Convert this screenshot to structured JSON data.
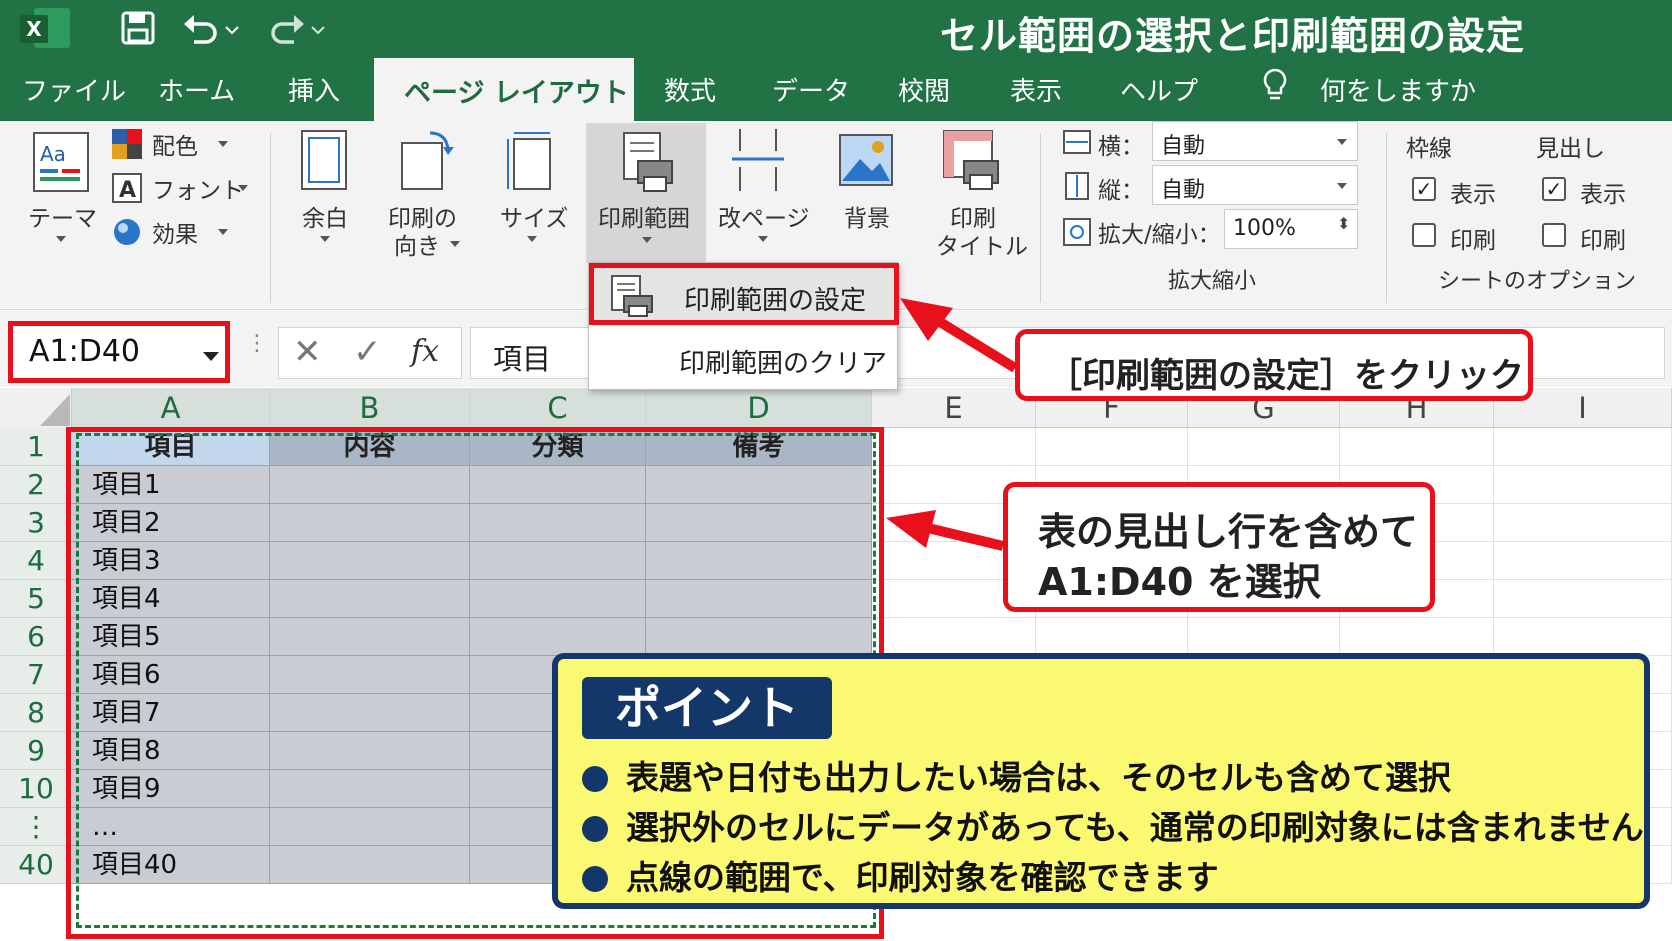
{
  "app": {
    "title": "セル範囲の選択と印刷範囲の設定",
    "logo_letter": "X",
    "colors": {
      "brand": "#217346",
      "highlight": "#e8111b",
      "point_bg": "#fbf871",
      "point_border": "#14376a"
    }
  },
  "quick_access": [
    "save-icon",
    "undo-icon",
    "redo-icon"
  ],
  "tabs": [
    "ファイル",
    "ホーム",
    "挿入",
    "ページ レイアウト",
    "数式",
    "データ",
    "校閲",
    "表示",
    "ヘルプ"
  ],
  "active_tab": "ページ レイアウト",
  "tell_me": "何をしますか",
  "ribbon": {
    "theme": {
      "label": "テーマ",
      "items": [
        "配色",
        "フォント",
        "効果"
      ]
    },
    "page_setup": {
      "margin": "余白",
      "orientation": [
        "印刷の",
        "向き"
      ],
      "size": "サイズ",
      "print_area": "印刷範囲",
      "breaks": "改ページ",
      "background": "背景",
      "print_titles": [
        "印刷",
        "タイトル"
      ]
    },
    "scale": {
      "width_label": "横：",
      "width_value": "自動",
      "height_label": "縦：",
      "height_value": "自動",
      "scale_label": "拡大/縮小：",
      "scale_value": "100%",
      "group_label": "拡大縮小"
    },
    "sheet_options": {
      "gridlines": "枠線",
      "headings": "見出し",
      "view": "表示",
      "print": "印刷",
      "group_label": "シートのオプション",
      "gridlines_view_checked": true,
      "gridlines_print_checked": false,
      "headings_view_checked": true,
      "headings_print_checked": false
    }
  },
  "menu": {
    "set": "印刷範囲の設定",
    "clear": "印刷範囲のクリア"
  },
  "formula_bar": {
    "name_box": "A1:D40",
    "value": "項目",
    "fx": "fx"
  },
  "columns": [
    "A",
    "B",
    "C",
    "D",
    "E",
    "F",
    "G",
    "H",
    "I"
  ],
  "rows": [
    "1",
    "2",
    "3",
    "4",
    "5",
    "6",
    "7",
    "8",
    "9",
    "10",
    "⋮",
    "40"
  ],
  "table": {
    "headers": [
      "項目",
      "内容",
      "分類",
      "備考"
    ],
    "items": [
      "項目1",
      "項目2",
      "項目3",
      "項目4",
      "項目5",
      "項目6",
      "項目7",
      "項目8",
      "項目9",
      "…",
      "項目40"
    ]
  },
  "callouts": {
    "click": "［印刷範囲の設定］をクリック",
    "select_1": "表の見出し行を含めて",
    "select_2": "A1:D40 を選択"
  },
  "point": {
    "title": "ポイント",
    "lines": [
      "表題や日付も出力したい場合は、そのセルも含めて選択",
      "選択外のセルにデータがあっても、通常の印刷対象には含まれません",
      "点線の範囲で、印刷対象を確認できます"
    ]
  }
}
